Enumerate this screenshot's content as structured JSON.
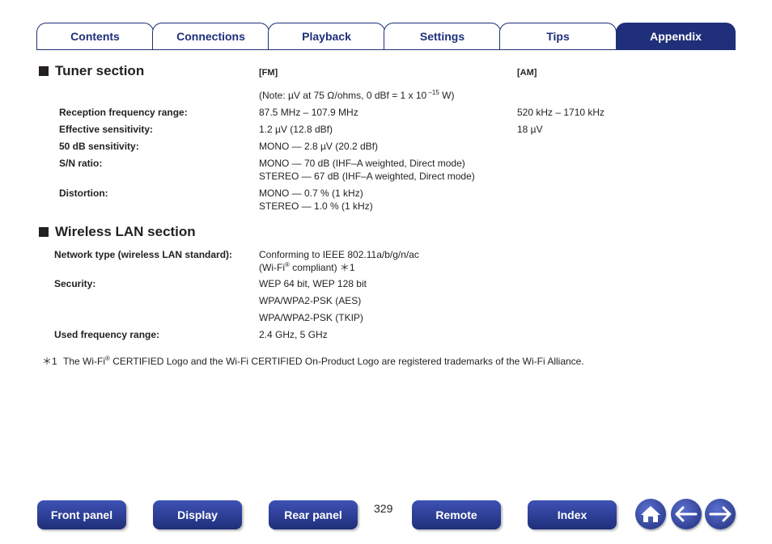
{
  "tabs": [
    {
      "label": "Contents"
    },
    {
      "label": "Connections"
    },
    {
      "label": "Playback"
    },
    {
      "label": "Settings"
    },
    {
      "label": "Tips"
    },
    {
      "label": "Appendix"
    }
  ],
  "tuner": {
    "title": "Tuner section",
    "fm_header": "[FM]",
    "am_header": "[AM]",
    "note_prefix": "(Note: µV at 75 Ω/ohms, 0 dBf = 1 x 10",
    "note_exp": " –15",
    "note_suffix": " W)",
    "rows": [
      {
        "label": "Reception frequency range:",
        "fm": "87.5 MHz – 107.9 MHz",
        "am": "520 kHz – 1710 kHz"
      },
      {
        "label": "Effective sensitivity:",
        "fm": "1.2 µV (12.8 dBf)",
        "am": "18 µV"
      },
      {
        "label": "50 dB sensitivity:",
        "fm": "MONO — 2.8 µV (20.2 dBf)"
      },
      {
        "label": "S/N ratio:",
        "fm": "MONO — 70 dB (IHF–A weighted, Direct mode)",
        "fm2": "STEREO — 67 dB (IHF–A weighted, Direct mode)"
      },
      {
        "label": "Distortion:",
        "fm": "MONO — 0.7 % (1 kHz)",
        "fm2": "STEREO — 1.0 % (1 kHz)"
      }
    ]
  },
  "wlan": {
    "title": "Wireless LAN section",
    "network_label": "Network type (wireless LAN standard):",
    "network_value": "Conforming to IEEE 802.11a/b/g/n/ac",
    "network_value2_a": "(Wi-Fi",
    "network_value2_reg": "®",
    "network_value2_b": " compliant) ＊1",
    "security_label": "Security:",
    "security_values": [
      "WEP 64 bit, WEP 128 bit",
      "WPA/WPA2-PSK (AES)",
      "WPA/WPA2-PSK (TKIP)"
    ],
    "freq_label": "Used frequency range:",
    "freq_value": "2.4 GHz, 5 GHz"
  },
  "footnote": {
    "mark": "＊1",
    "text_a": "The Wi-Fi",
    "reg": "®",
    "text_b": " CERTIFIED Logo and the Wi-Fi CERTIFIED On-Product Logo are registered trademarks of the Wi-Fi Alliance."
  },
  "bottom_nav": {
    "front_panel": "Front panel",
    "display": "Display",
    "rear_panel": "Rear panel",
    "page_number": "329",
    "remote": "Remote",
    "index": "Index",
    "icons": [
      "home-icon",
      "arrow-left-icon",
      "arrow-right-icon"
    ]
  }
}
